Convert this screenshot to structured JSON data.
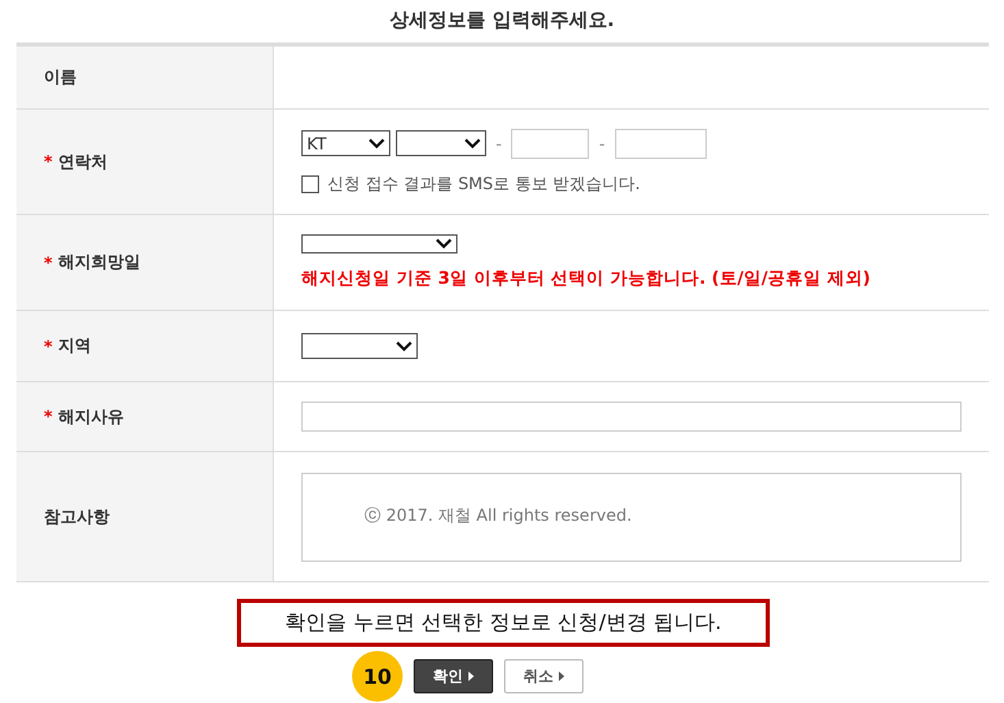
{
  "title": "상세정보를 입력해주세요.",
  "rows": [
    {
      "label": "이름",
      "kind": "text",
      "required": false
    },
    {
      "label": "연락처",
      "kind": "phone",
      "required": true,
      "carrier": "KT",
      "prefix": "",
      "separators": [
        "-",
        "-"
      ],
      "sms_opt_in": {
        "checked": false,
        "label": "신청 접수 결과를 SMS로 통보 받겠습니다."
      }
    },
    {
      "label": "해지희망일",
      "kind": "date",
      "required": true,
      "value": "",
      "note": "해지신청일 기준 3일 이후부터 선택이 가능합니다. (토/일/공휴일 제외)"
    },
    {
      "label": "지역",
      "kind": "select",
      "required": true,
      "value": ""
    },
    {
      "label": "해지사유",
      "kind": "input",
      "required": true,
      "value": ""
    },
    {
      "label": "참고사항",
      "kind": "textarea",
      "required": false,
      "value": "ⓒ 2017. 재철 All rights reserved."
    }
  ],
  "required_marker": "*",
  "notice": "확인을 누르면 선택한 정보로 신청/변경 됩니다.",
  "step_badge": "10",
  "buttons": [
    {
      "label": "확인",
      "kind": "primary"
    },
    {
      "label": "취소",
      "kind": "secondary"
    }
  ]
}
